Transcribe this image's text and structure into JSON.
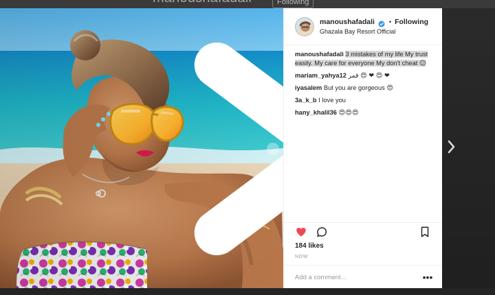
{
  "background": {
    "username": "manoushafadali",
    "following_label": "Following"
  },
  "post": {
    "username": "manoushafadali",
    "follow_status": "Following",
    "location": "Ghazala Bay Resort Official",
    "caption": "3 mistakes of my life My trust easily. My care for everyone My don't cheat 😐",
    "comments": [
      {
        "user": "mariam_yahya12",
        "text": "قمر 😍 ❤ 😍 ❤"
      },
      {
        "user": "iyasalem",
        "text": "But you are gorgeous 😍"
      },
      {
        "user": "3a_k_b",
        "text": "I love you"
      },
      {
        "user": "hany_khalil36",
        "text": "😍😍😍"
      }
    ],
    "likes": "184 likes",
    "time_ago": "NOW",
    "add_comment_placeholder": "Add a comment…",
    "more_symbol": "•••"
  },
  "icons": {
    "like": "heart-icon",
    "comment": "comment-icon",
    "save": "bookmark-icon",
    "verified": "verified-badge-icon",
    "photo_next": "chevron-right-icon",
    "modal_next": "chevron-right-icon"
  },
  "colors": {
    "like_red": "#ed4956",
    "verified_blue": "#3897f0",
    "text": "#262626",
    "muted": "#999999"
  }
}
